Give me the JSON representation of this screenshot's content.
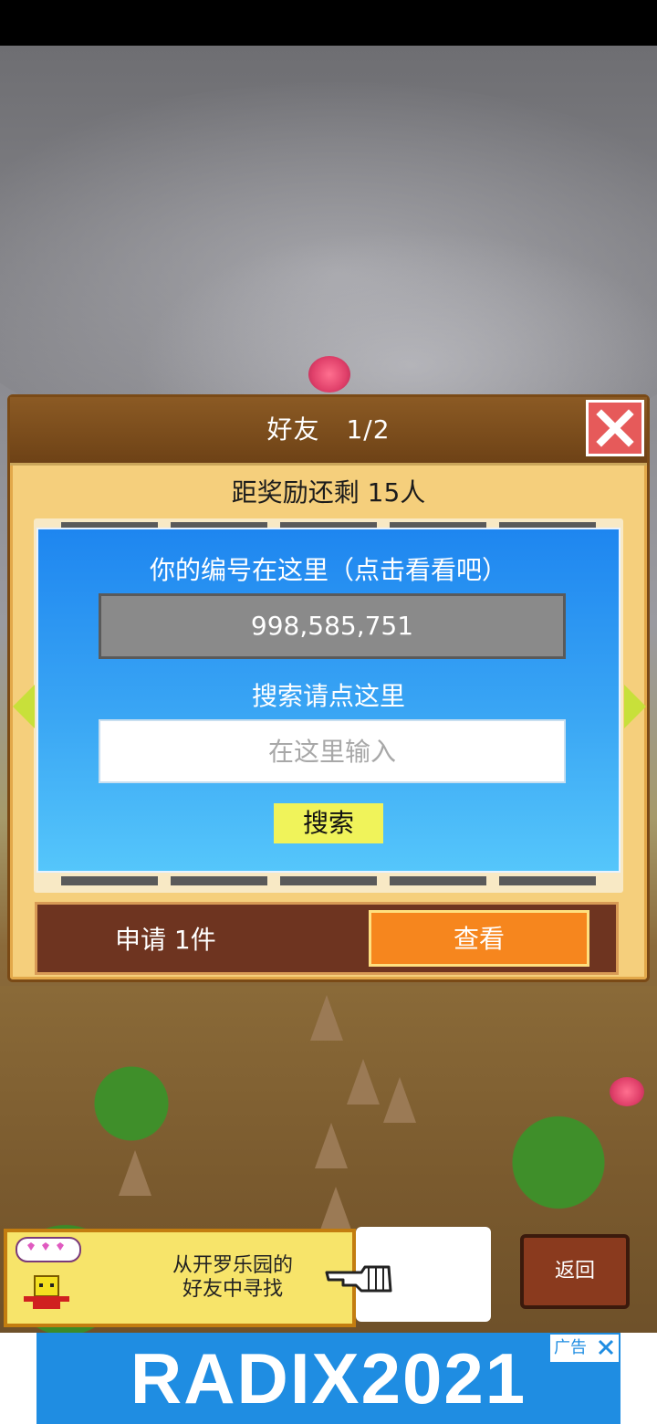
{
  "dialog": {
    "title": "好友　1/2",
    "reward_text": "距奖励还剩 15人",
    "id_caption": "你的编号在这里（点击看看吧）",
    "id_value": "998,585,751",
    "search_caption": "搜索请点这里",
    "search_placeholder": "在这里输入",
    "search_button": "搜索",
    "request_text": "申请 1件",
    "view_button": "查看"
  },
  "hint": {
    "line1": "从开罗乐园的",
    "line2": "好友中寻找"
  },
  "back_button": "返回",
  "ad": {
    "banner_text": "RADIX2021",
    "label": "广告"
  },
  "colors": {
    "panel_blue": "#1e86f0",
    "view_button": "#f6861e",
    "close_button": "#e65a5a",
    "search_button": "#f0f35a"
  }
}
